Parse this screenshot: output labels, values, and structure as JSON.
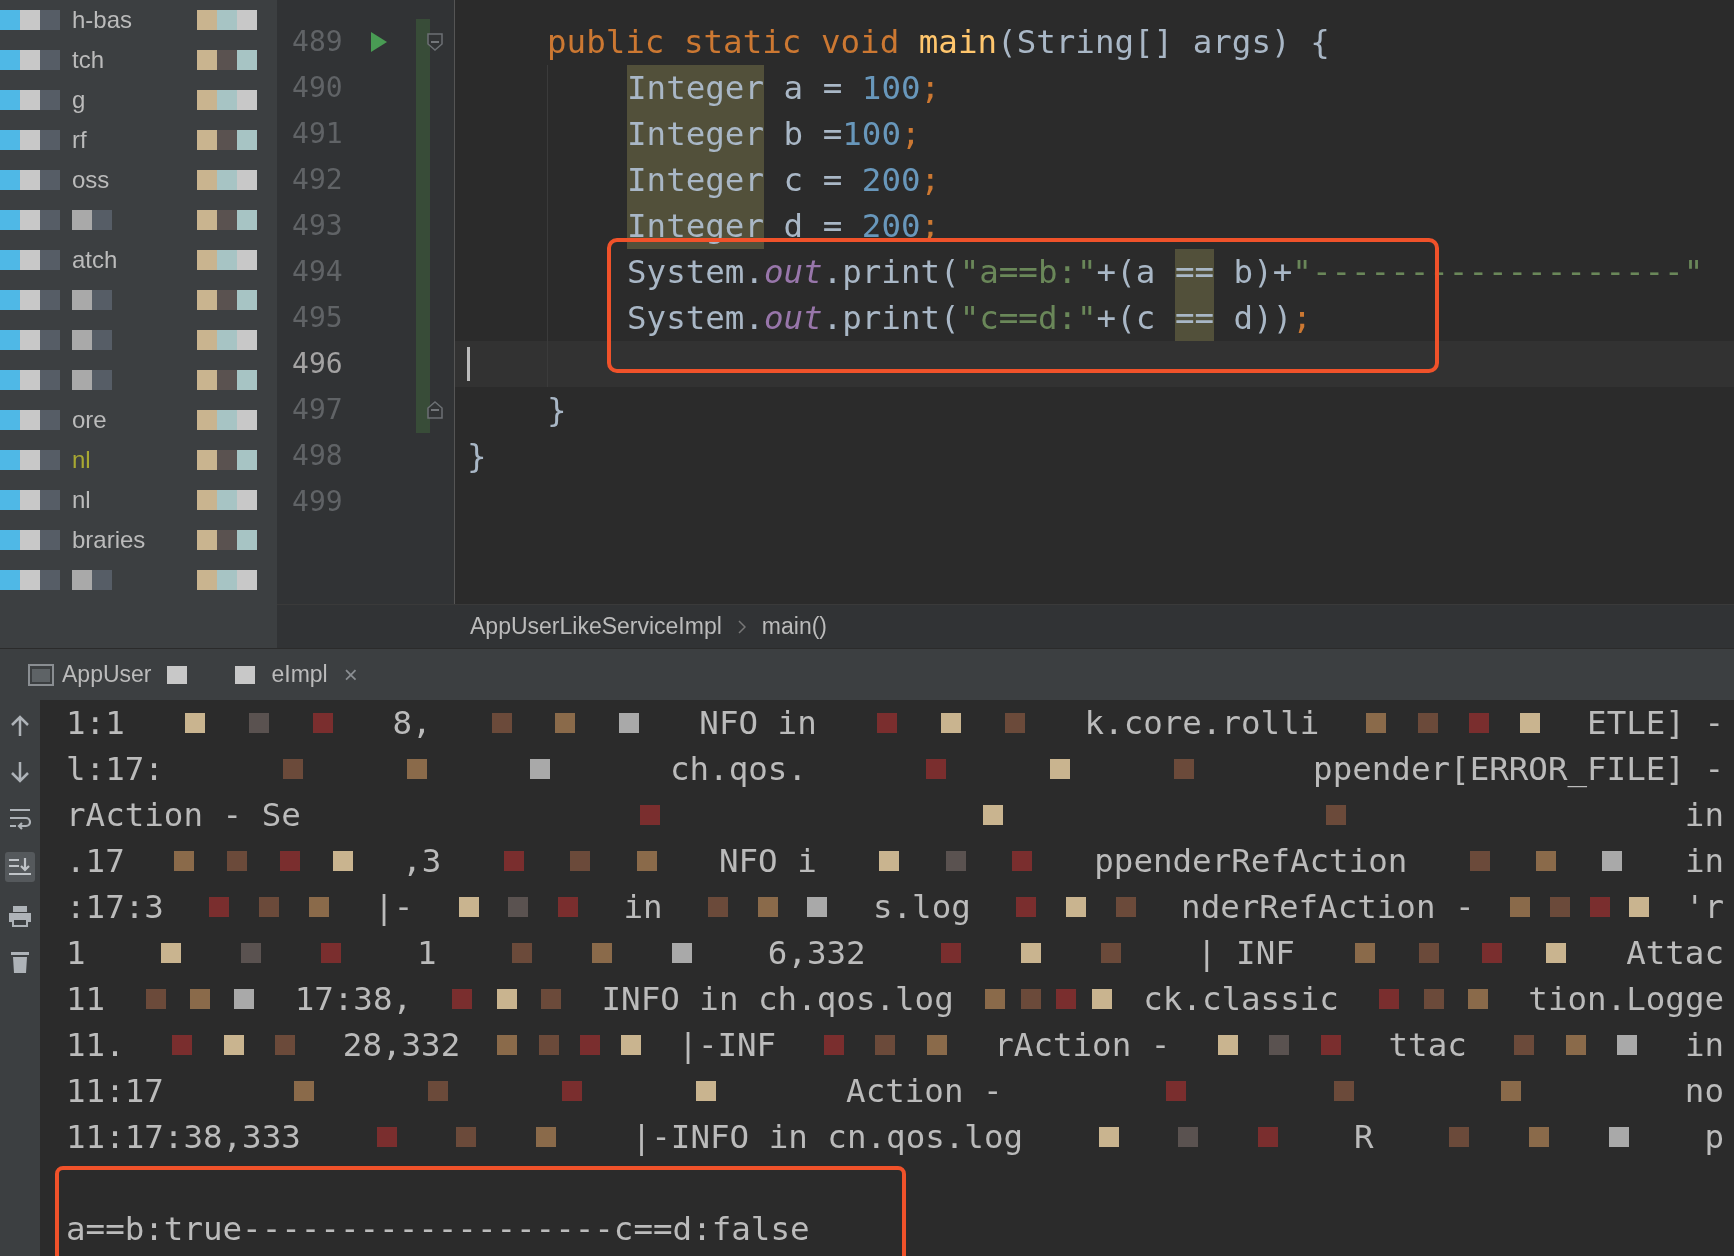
{
  "sidebar": {
    "items": [
      {
        "kind": "text",
        "fragment": "h-bas",
        "color": "#bbbbbb"
      },
      {
        "kind": "text",
        "fragment": "tch",
        "color": "#bbbbbb"
      },
      {
        "kind": "text",
        "fragment": "g",
        "color": "#bbbbbb"
      },
      {
        "kind": "text",
        "fragment": "rf",
        "color": "#bbbbbb"
      },
      {
        "kind": "text",
        "fragment": "oss",
        "color": "#bbbbbb"
      },
      {
        "kind": "masked"
      },
      {
        "kind": "text",
        "fragment": "atch",
        "color": "#bbbbbb"
      },
      {
        "kind": "masked"
      },
      {
        "kind": "masked"
      },
      {
        "kind": "masked"
      },
      {
        "kind": "text",
        "fragment": "ore",
        "color": "#bbbbbb"
      },
      {
        "kind": "text",
        "fragment": "nl",
        "color": "#a8a832"
      },
      {
        "kind": "text",
        "fragment": "nl",
        "color": "#bbbbbb"
      },
      {
        "kind": "text",
        "fragment": "braries",
        "color": "#bbbbbb"
      },
      {
        "kind": "masked"
      }
    ]
  },
  "editor": {
    "lines": [
      {
        "number": "489",
        "kind": "member",
        "run": true,
        "fold_start": true,
        "fold_end": false,
        "changed": true,
        "current": false,
        "tokens": [
          {
            "kind": "keyword",
            "text": "public static void "
          },
          {
            "kind": "method",
            "text": "main"
          },
          {
            "kind": "plain",
            "text": "(String[] args) {"
          }
        ]
      },
      {
        "number": "490",
        "kind": "statement",
        "run": false,
        "fold_start": false,
        "fold_end": false,
        "changed": true,
        "current": false,
        "tokens": [
          {
            "kind": "usage",
            "text": "Integer"
          },
          {
            "kind": "plain",
            "text": " a = "
          },
          {
            "kind": "number",
            "text": "100"
          },
          {
            "kind": "keyword",
            "text": ";"
          }
        ]
      },
      {
        "number": "491",
        "kind": "statement",
        "run": false,
        "fold_start": false,
        "fold_end": false,
        "changed": true,
        "current": false,
        "tokens": [
          {
            "kind": "usage",
            "text": "Integer"
          },
          {
            "kind": "plain",
            "text": " b ="
          },
          {
            "kind": "number",
            "text": "100"
          },
          {
            "kind": "keyword",
            "text": ";"
          }
        ]
      },
      {
        "number": "492",
        "kind": "statement",
        "run": false,
        "fold_start": false,
        "fold_end": false,
        "changed": true,
        "current": false,
        "tokens": [
          {
            "kind": "usage",
            "text": "Integer"
          },
          {
            "kind": "plain",
            "text": " c = "
          },
          {
            "kind": "number",
            "text": "200"
          },
          {
            "kind": "keyword",
            "text": ";"
          }
        ]
      },
      {
        "number": "493",
        "kind": "statement",
        "run": false,
        "fold_start": false,
        "fold_end": false,
        "changed": true,
        "current": false,
        "tokens": [
          {
            "kind": "usage",
            "text": "Integer"
          },
          {
            "kind": "plain",
            "text": " d = "
          },
          {
            "kind": "number",
            "text": "200"
          },
          {
            "kind": "keyword",
            "text": ";"
          }
        ]
      },
      {
        "number": "494",
        "kind": "statement",
        "run": false,
        "fold_start": false,
        "fold_end": false,
        "changed": true,
        "current": false,
        "tokens": [
          {
            "kind": "plain",
            "text": "System."
          },
          {
            "kind": "field",
            "text": "out"
          },
          {
            "kind": "plain",
            "text": ".print("
          },
          {
            "kind": "string",
            "text": "\"a==b:\""
          },
          {
            "kind": "plain",
            "text": "+(a "
          },
          {
            "kind": "usage",
            "text": "=="
          },
          {
            "kind": "plain",
            "text": " b)+"
          },
          {
            "kind": "string",
            "text": "\"-------------------\""
          }
        ]
      },
      {
        "number": "495",
        "kind": "statement",
        "run": false,
        "fold_start": false,
        "fold_end": false,
        "changed": true,
        "current": false,
        "tokens": [
          {
            "kind": "plain",
            "text": "System."
          },
          {
            "kind": "field",
            "text": "out"
          },
          {
            "kind": "plain",
            "text": ".print("
          },
          {
            "kind": "string",
            "text": "\"c==d:\""
          },
          {
            "kind": "plain",
            "text": "+(c "
          },
          {
            "kind": "usage",
            "text": "=="
          },
          {
            "kind": "plain",
            "text": " d))"
          },
          {
            "kind": "keyword",
            "text": ";"
          }
        ]
      },
      {
        "number": "496",
        "run": false,
        "fold_start": false,
        "fold_end": false,
        "changed": true,
        "current": true
      },
      {
        "number": "497",
        "kind": "member",
        "run": false,
        "fold_start": false,
        "fold_end": true,
        "changed": true,
        "current": false,
        "tokens": [
          {
            "kind": "plain",
            "text": "}"
          }
        ]
      },
      {
        "number": "498",
        "kind": "class",
        "run": false,
        "fold_start": false,
        "fold_end": false,
        "changed": false,
        "current": false,
        "tokens": [
          {
            "kind": "plain",
            "text": "}"
          }
        ]
      },
      {
        "number": "499",
        "run": false,
        "fold_start": false,
        "fold_end": false,
        "changed": false,
        "current": false
      }
    ]
  },
  "breadcrumb": [
    "AppUserLikeServiceImpl",
    "main()"
  ],
  "run_tab": {
    "fragments": [
      "AppUser",
      "eImpl"
    ],
    "close": "×"
  },
  "console": {
    "log_lines": [
      [
        "1:1",
        "8,",
        "NFO in",
        "k.core.rolli",
        "ETLE] -"
      ],
      [
        "l:17:",
        "ch.qos.",
        "ppender[ERROR_FILE] -"
      ],
      [
        "rAction - Se",
        "in"
      ],
      [
        ".17",
        ",3",
        "NFO i",
        "ppenderRefAction",
        "in"
      ],
      [
        ":17:3",
        "|-",
        "in",
        "s.log",
        "nderRefAction -",
        "'r"
      ],
      [
        "1",
        "1",
        "6,332",
        "| INF",
        "Attac"
      ],
      [
        "11",
        "17:38,",
        "INFO in ch.qos.log",
        "ck.classic",
        "tion.Logge"
      ],
      [
        "11.",
        "28,332",
        "|-INF",
        "rAction -",
        "ttac",
        "in"
      ],
      [
        "11:17",
        "Action -",
        "no"
      ],
      [
        "11:17:38,333",
        "|-INFO in cn.qos.log",
        "R",
        "p"
      ]
    ],
    "output": "a==b:true-------------------c==d:false"
  }
}
